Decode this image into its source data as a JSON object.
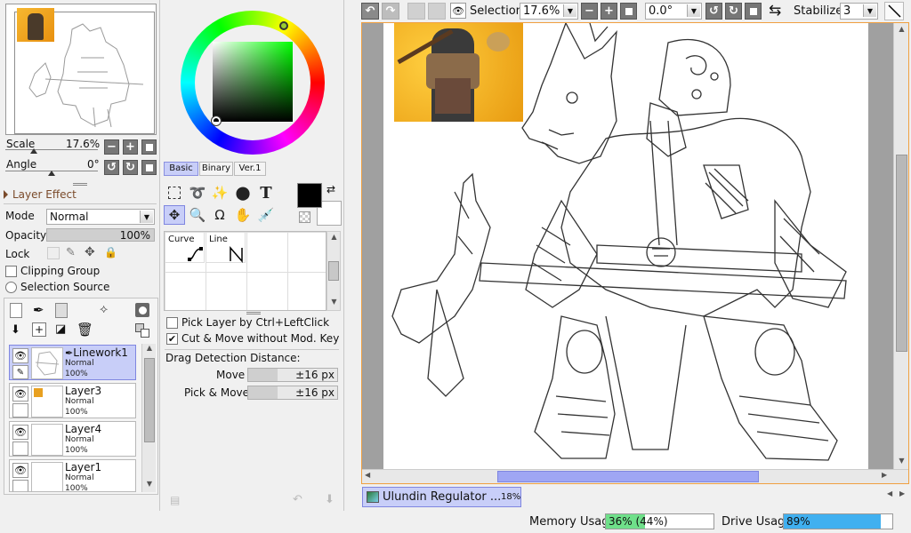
{
  "navigator": {
    "scale_label": "Scale",
    "scale_value": "17.6%",
    "angle_label": "Angle",
    "angle_value": "0°"
  },
  "layer_effect": {
    "title": "Layer Effect",
    "mode_label": "Mode",
    "mode_value": "Normal",
    "opacity_label": "Opacity",
    "opacity_value": "100%",
    "opacity_fraction": 1.0,
    "lock_label": "Lock",
    "clipping_group": "Clipping Group",
    "selection_source": "Selection Source"
  },
  "layers": [
    {
      "name": "Linework1",
      "mode": "Normal",
      "opacity": "100%",
      "selected": true
    },
    {
      "name": "Layer3",
      "mode": "Normal",
      "opacity": "100%",
      "selected": false
    },
    {
      "name": "Layer4",
      "mode": "Normal",
      "opacity": "100%",
      "selected": false
    },
    {
      "name": "Layer1",
      "mode": "Normal",
      "opacity": "100%",
      "selected": false
    }
  ],
  "color_tabs": {
    "basic": "Basic",
    "binary": "Binary",
    "ver1": "Ver.1"
  },
  "tool_settings": {
    "curve": "Curve",
    "line": "Line",
    "pick_layer": "Pick Layer by Ctrl+LeftClick",
    "cut_move": "Cut & Move without Mod. Key",
    "cut_move_checked": true,
    "pick_layer_checked": false,
    "drag_detection": "Drag Detection Distance:",
    "move_label": "Move",
    "move_value": "±16 px",
    "pick_move_label": "Pick & Move",
    "pick_move_value": "±16 px"
  },
  "toolbar": {
    "selection_label": "Selection",
    "zoom_value": "17.6%",
    "angle_value": "0.0°",
    "stabilizer_label": "Stabilizer",
    "stabilizer_value": "3"
  },
  "document": {
    "name": "Ulundin Regulator ...",
    "zoom": "18%"
  },
  "status": {
    "memory_label": "Memory Usage",
    "memory_value": "36% (44%)",
    "memory_fraction": 0.36,
    "drive_label": "Drive Usage",
    "drive_value": "89%",
    "drive_fraction": 0.89
  },
  "colors": {
    "accent": "#6f78f0",
    "selected_layer": "#c8cef8",
    "canvas_border": "#f0a040",
    "memory_bar": "#6fe08a",
    "drive_bar": "#40b0f0"
  },
  "icons": {
    "undo": "undo-icon",
    "redo": "redo-icon",
    "eye": "eye-icon",
    "zoom_in": "plus-icon",
    "zoom_out": "minus-icon",
    "rotate_left": "rotate-left-icon"
  }
}
